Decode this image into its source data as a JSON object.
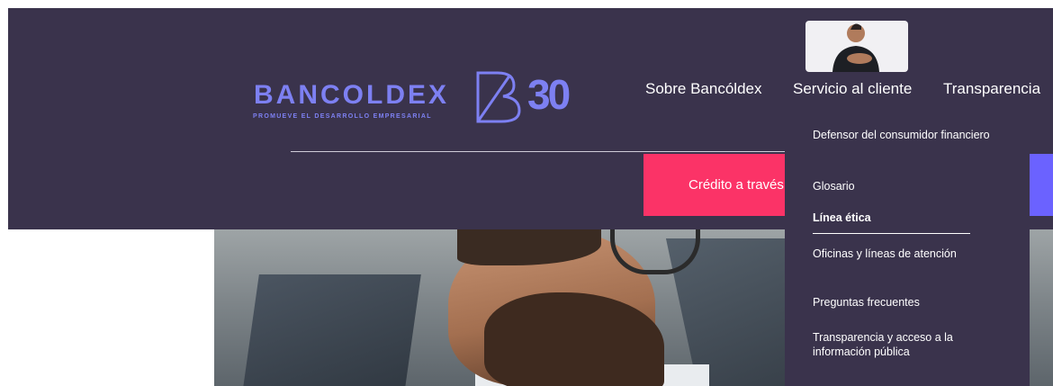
{
  "brand": {
    "name": "BANCOLDEX",
    "tagline": "PROMUEVE EL DESARROLLO EMPRESARIAL",
    "anniversary": "30",
    "color": "#7d80f2"
  },
  "nav": {
    "items": [
      {
        "label": "Sobre Bancóldex"
      },
      {
        "label": "Servicio al cliente"
      },
      {
        "label": "Transparencia"
      }
    ]
  },
  "cta": {
    "credit_label": "Crédito a través",
    "credit_color": "#fb3367",
    "secondary_color": "#6b62ff"
  },
  "dropdown": {
    "items": [
      {
        "label": "Defensor del consumidor financiero"
      },
      {
        "label": "Glosario"
      },
      {
        "label": "Línea ética"
      },
      {
        "label": "Oficinas y líneas de atención"
      },
      {
        "label": "Preguntas frecuentes"
      },
      {
        "label": "Transparencia y acceso a la información pública"
      }
    ]
  },
  "theme": {
    "header_bg": "#3a334c"
  }
}
